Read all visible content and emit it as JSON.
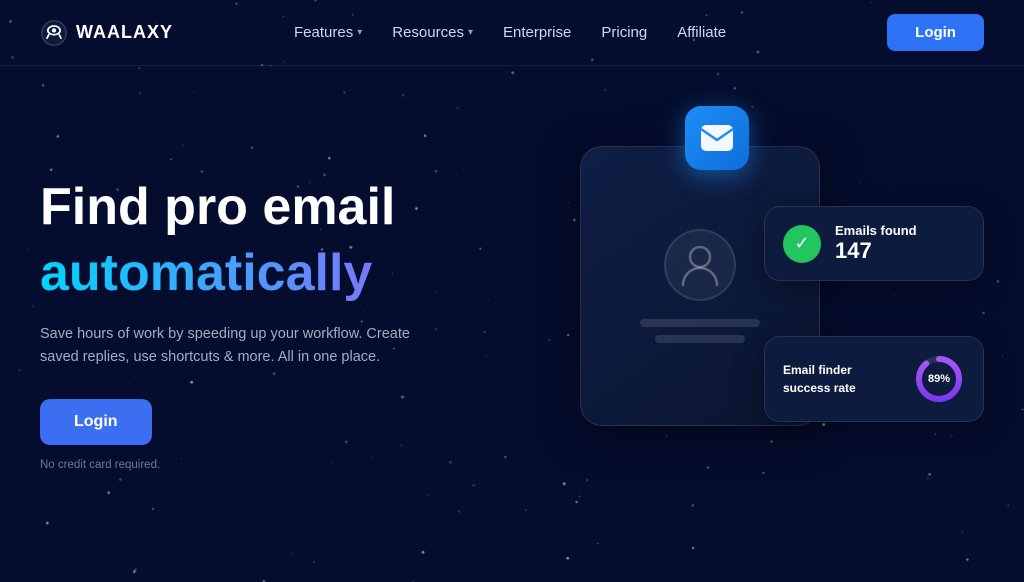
{
  "brand": {
    "name": "WAALAXY",
    "logo_alt": "Waalaxy alien logo"
  },
  "nav": {
    "links": [
      {
        "label": "Features",
        "has_dropdown": true
      },
      {
        "label": "Resources",
        "has_dropdown": true
      },
      {
        "label": "Enterprise",
        "has_dropdown": false
      },
      {
        "label": "Pricing",
        "has_dropdown": false
      },
      {
        "label": "Affiliate",
        "has_dropdown": false
      }
    ],
    "login_label": "Login"
  },
  "hero": {
    "title_line1": "Find pro email",
    "title_line2": "automatically",
    "subtitle": "Save hours of work by speeding up your workflow. Create saved replies, use shortcuts & more. All in one place.",
    "login_button": "Login",
    "no_credit_text": "No credit card required."
  },
  "stats_card1": {
    "label": "Emails found",
    "count": "147"
  },
  "stats_card2": {
    "label": "Email finder success rate",
    "percent": "89%",
    "percent_num": 89
  },
  "colors": {
    "accent_blue": "#2d72f5",
    "accent_gradient_start": "#00d4ff",
    "accent_gradient_end": "#a855f7",
    "bg_dark": "#050d2e",
    "card_bg": "#0d1b3e",
    "green": "#22c55e"
  }
}
